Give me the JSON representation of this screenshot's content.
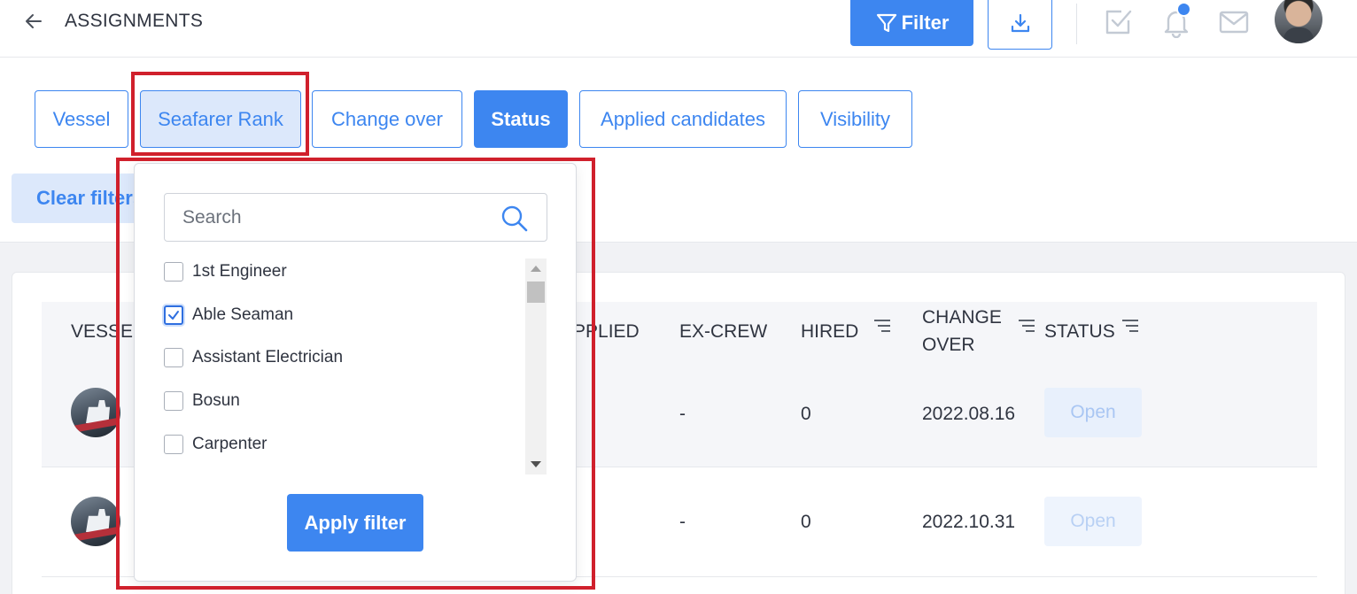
{
  "header": {
    "title": "ASSIGNMENTS",
    "filter_label": "Filter",
    "icons": [
      "back-arrow-icon",
      "filter-funnel-icon",
      "download-icon",
      "tasks-check-icon",
      "bell-icon",
      "mail-icon",
      "user-avatar"
    ]
  },
  "tabs": [
    {
      "label": "Vessel",
      "state": "default"
    },
    {
      "label": "Seafarer Rank",
      "state": "open"
    },
    {
      "label": "Change over",
      "state": "default"
    },
    {
      "label": "Status",
      "state": "active"
    },
    {
      "label": "Applied candidates",
      "state": "default"
    },
    {
      "label": "Visibility",
      "state": "default"
    }
  ],
  "clear_filters_label": "Clear filters",
  "dropdown": {
    "search_placeholder": "Search",
    "options": [
      {
        "label": "1st Engineer",
        "checked": false
      },
      {
        "label": "Able Seaman",
        "checked": true
      },
      {
        "label": "Assistant Electrician",
        "checked": false
      },
      {
        "label": "Bosun",
        "checked": false
      },
      {
        "label": "Carpenter",
        "checked": false
      }
    ],
    "apply_label": "Apply filter"
  },
  "table": {
    "headers": {
      "vessel": "VESSEL",
      "applied": "PPLIED",
      "ex_crew": "EX-CREW",
      "hired": "HIRED",
      "change_over_1": "CHANGE",
      "change_over_2": "OVER",
      "status": "STATUS"
    },
    "rows": [
      {
        "ex_crew": "-",
        "hired": "0",
        "change_over": "2022.08.16",
        "status": "Open"
      },
      {
        "ex_crew": "-",
        "hired": "0",
        "change_over": "2022.10.31",
        "status": "Open"
      }
    ]
  },
  "colors": {
    "accent": "#3d86f0",
    "highlight_box": "#d0202c",
    "status_bg": "#e8f0fc"
  }
}
